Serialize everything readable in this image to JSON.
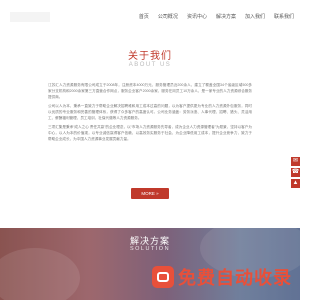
{
  "nav": {
    "items": [
      {
        "label": "首页",
        "active": false
      },
      {
        "label": "公司概况",
        "active": false
      },
      {
        "label": "资讯中心",
        "active": false
      },
      {
        "label": "解决方案",
        "active": false
      },
      {
        "label": "加入我们",
        "active": false
      },
      {
        "label": "联系我们",
        "active": false
      }
    ]
  },
  "about": {
    "title": "关于我们",
    "subtitle": "ABOUT US",
    "paragraphs": [
      "江苏汇人力资源服务有限公司成立于2008年，注册资本4000万元，服务管理员近200余人，建立了覆盖全国34个省级区域500多家分支机构和2000余家第三方直营合作网点，服务企业客户2000余家，服务在岗员工10万余人，是一家专业的人力资源综合服务提供商。",
      "公司以人为本，秉承一直致力于帮助企业解决招聘难和用工成本过高的问题，以为客户提供更为专业的人力资源外包服务，同时以优质的专业服务和完善的管理体系，获得了众多客户的高度认可。公司业务涵盖：劳务派遣、人事代理、招聘、猎头、灵活用工、薪酬福利管理、员工培训、社保代缴等人力资源服务。",
      "三项汇集是秉承“成人之心 责任共赢”的企业理念，以“市场人力资源服务先导者，成为企业人力资源管理者”为愿景，坚持以客户为中心，以人为本的价值观，以专业诚信赢得客户信赖，以高效务实服务于社会，为企业降低用工成本，提升企业竞争力，致力于帮助企业成长，为中国人力资源事业发展贡献力量。"
    ],
    "more_label": "MORE »"
  },
  "side_tools": [
    "✉",
    "☎",
    "▲"
  ],
  "solution": {
    "title": "解决方案",
    "subtitle": "SOLUTION"
  },
  "watermark": {
    "text": "免费自动收录"
  }
}
